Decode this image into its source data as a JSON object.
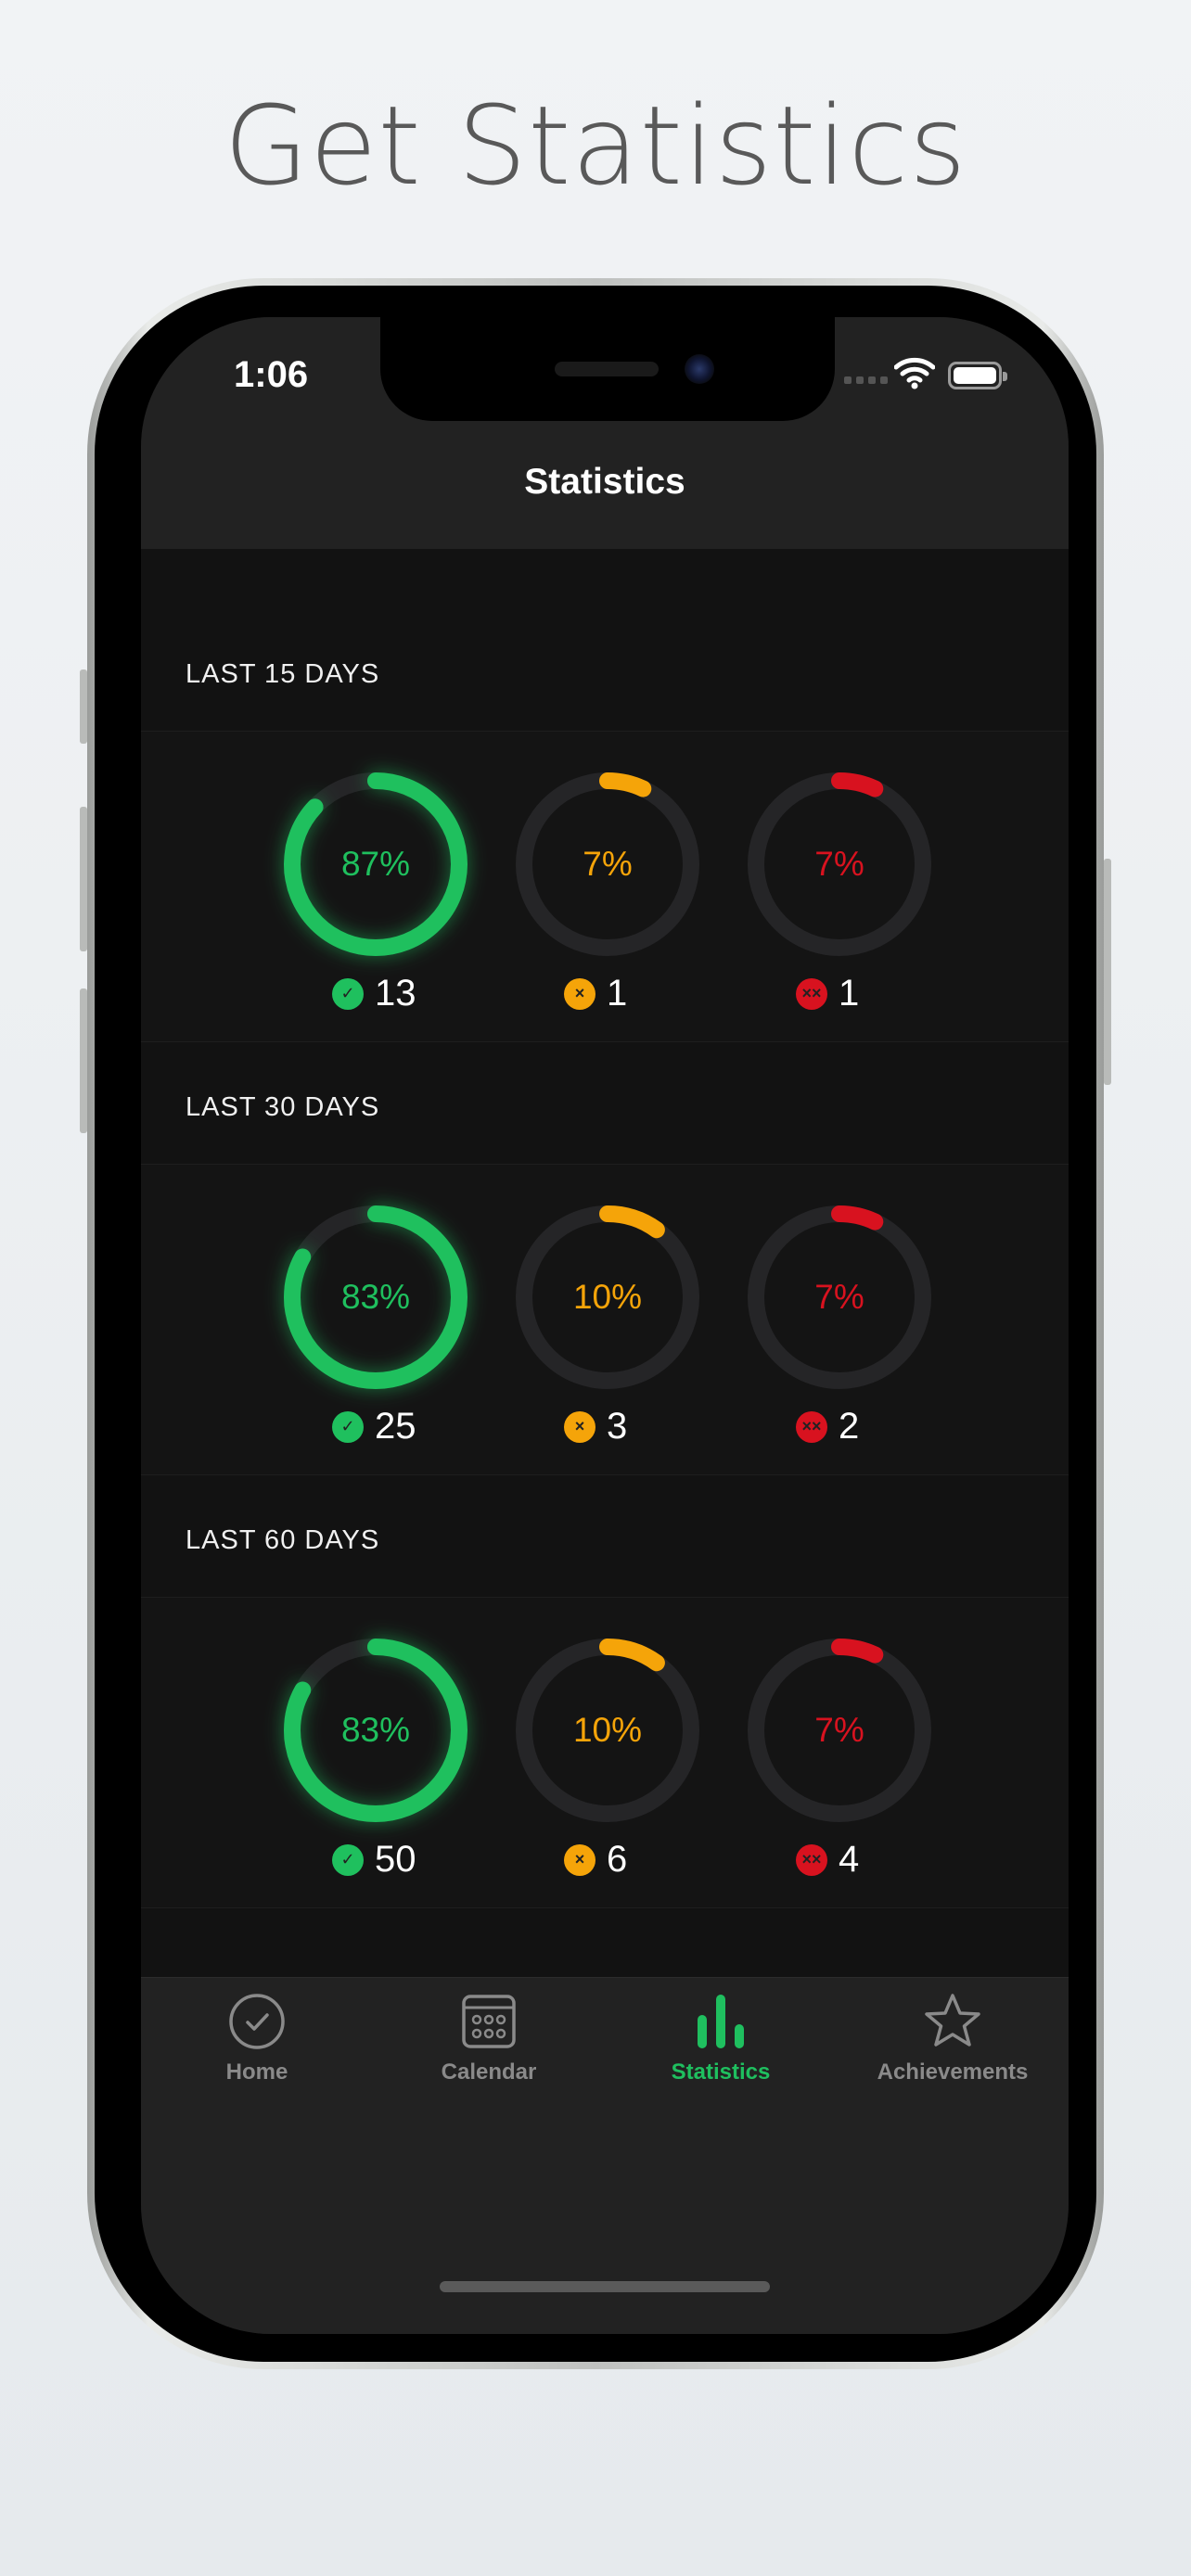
{
  "headline": "Get Statistics",
  "status": {
    "time": "1:06"
  },
  "nav": {
    "title": "Statistics"
  },
  "colors": {
    "success": "#1fc05e",
    "skip": "#f5a409",
    "fail": "#d8121f",
    "track": "#252527"
  },
  "sections": [
    {
      "label": "LAST 15 DAYS",
      "stats": [
        {
          "kind": "success",
          "percent": 87,
          "percent_label": "87%",
          "count": "13",
          "badge": "✓"
        },
        {
          "kind": "skip",
          "percent": 7,
          "percent_label": "7%",
          "count": "1",
          "badge": "×"
        },
        {
          "kind": "fail",
          "percent": 7,
          "percent_label": "7%",
          "count": "1",
          "badge": "××"
        }
      ]
    },
    {
      "label": "LAST 30 DAYS",
      "stats": [
        {
          "kind": "success",
          "percent": 83,
          "percent_label": "83%",
          "count": "25",
          "badge": "✓"
        },
        {
          "kind": "skip",
          "percent": 10,
          "percent_label": "10%",
          "count": "3",
          "badge": "×"
        },
        {
          "kind": "fail",
          "percent": 7,
          "percent_label": "7%",
          "count": "2",
          "badge": "××"
        }
      ]
    },
    {
      "label": "LAST 60 DAYS",
      "stats": [
        {
          "kind": "success",
          "percent": 83,
          "percent_label": "83%",
          "count": "50",
          "badge": "✓"
        },
        {
          "kind": "skip",
          "percent": 10,
          "percent_label": "10%",
          "count": "6",
          "badge": "×"
        },
        {
          "kind": "fail",
          "percent": 7,
          "percent_label": "7%",
          "count": "4",
          "badge": "××"
        }
      ]
    }
  ],
  "tabs": [
    {
      "label": "Home",
      "icon": "checkmark-circle-icon",
      "active": false
    },
    {
      "label": "Calendar",
      "icon": "calendar-icon",
      "active": false
    },
    {
      "label": "Statistics",
      "icon": "bar-chart-icon",
      "active": true
    },
    {
      "label": "Achievements",
      "icon": "star-icon",
      "active": false
    }
  ]
}
